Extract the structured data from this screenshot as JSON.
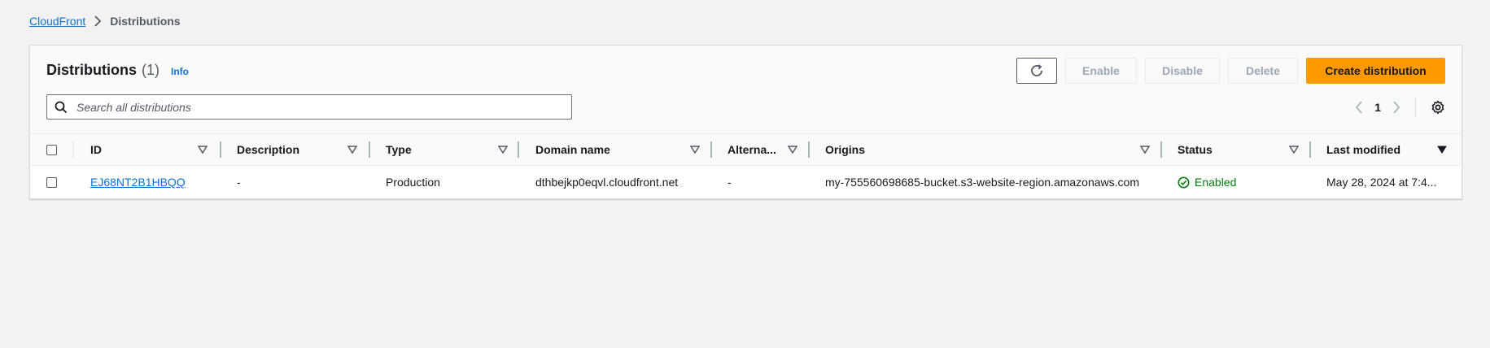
{
  "breadcrumb": {
    "root": "CloudFront",
    "current": "Distributions"
  },
  "header": {
    "title": "Distributions",
    "count": "(1)",
    "info": "Info"
  },
  "actions": {
    "refresh_icon": "refresh-icon",
    "enable": "Enable",
    "disable": "Disable",
    "delete": "Delete",
    "create": "Create distribution"
  },
  "search": {
    "placeholder": "Search all distributions",
    "value": ""
  },
  "pagination": {
    "current_page": "1"
  },
  "table": {
    "columns": [
      "ID",
      "Description",
      "Type",
      "Domain name",
      "Alterna...",
      "Origins",
      "Status",
      "Last modified"
    ],
    "rows": [
      {
        "id": "EJ68NT2B1HBQQ",
        "description": "-",
        "type": "Production",
        "domain": "dthbejkp0eqvl.cloudfront.net",
        "alternate": "-",
        "origins": "my-755560698685-bucket.s3-website-region.amazonaws.com",
        "status": "Enabled",
        "last_modified": "May 28, 2024 at 7:4..."
      }
    ]
  },
  "colors": {
    "accent_link": "#0972d3",
    "primary_button": "#ff9900",
    "status_success": "#037f0c",
    "background": "#f2f2f2"
  }
}
